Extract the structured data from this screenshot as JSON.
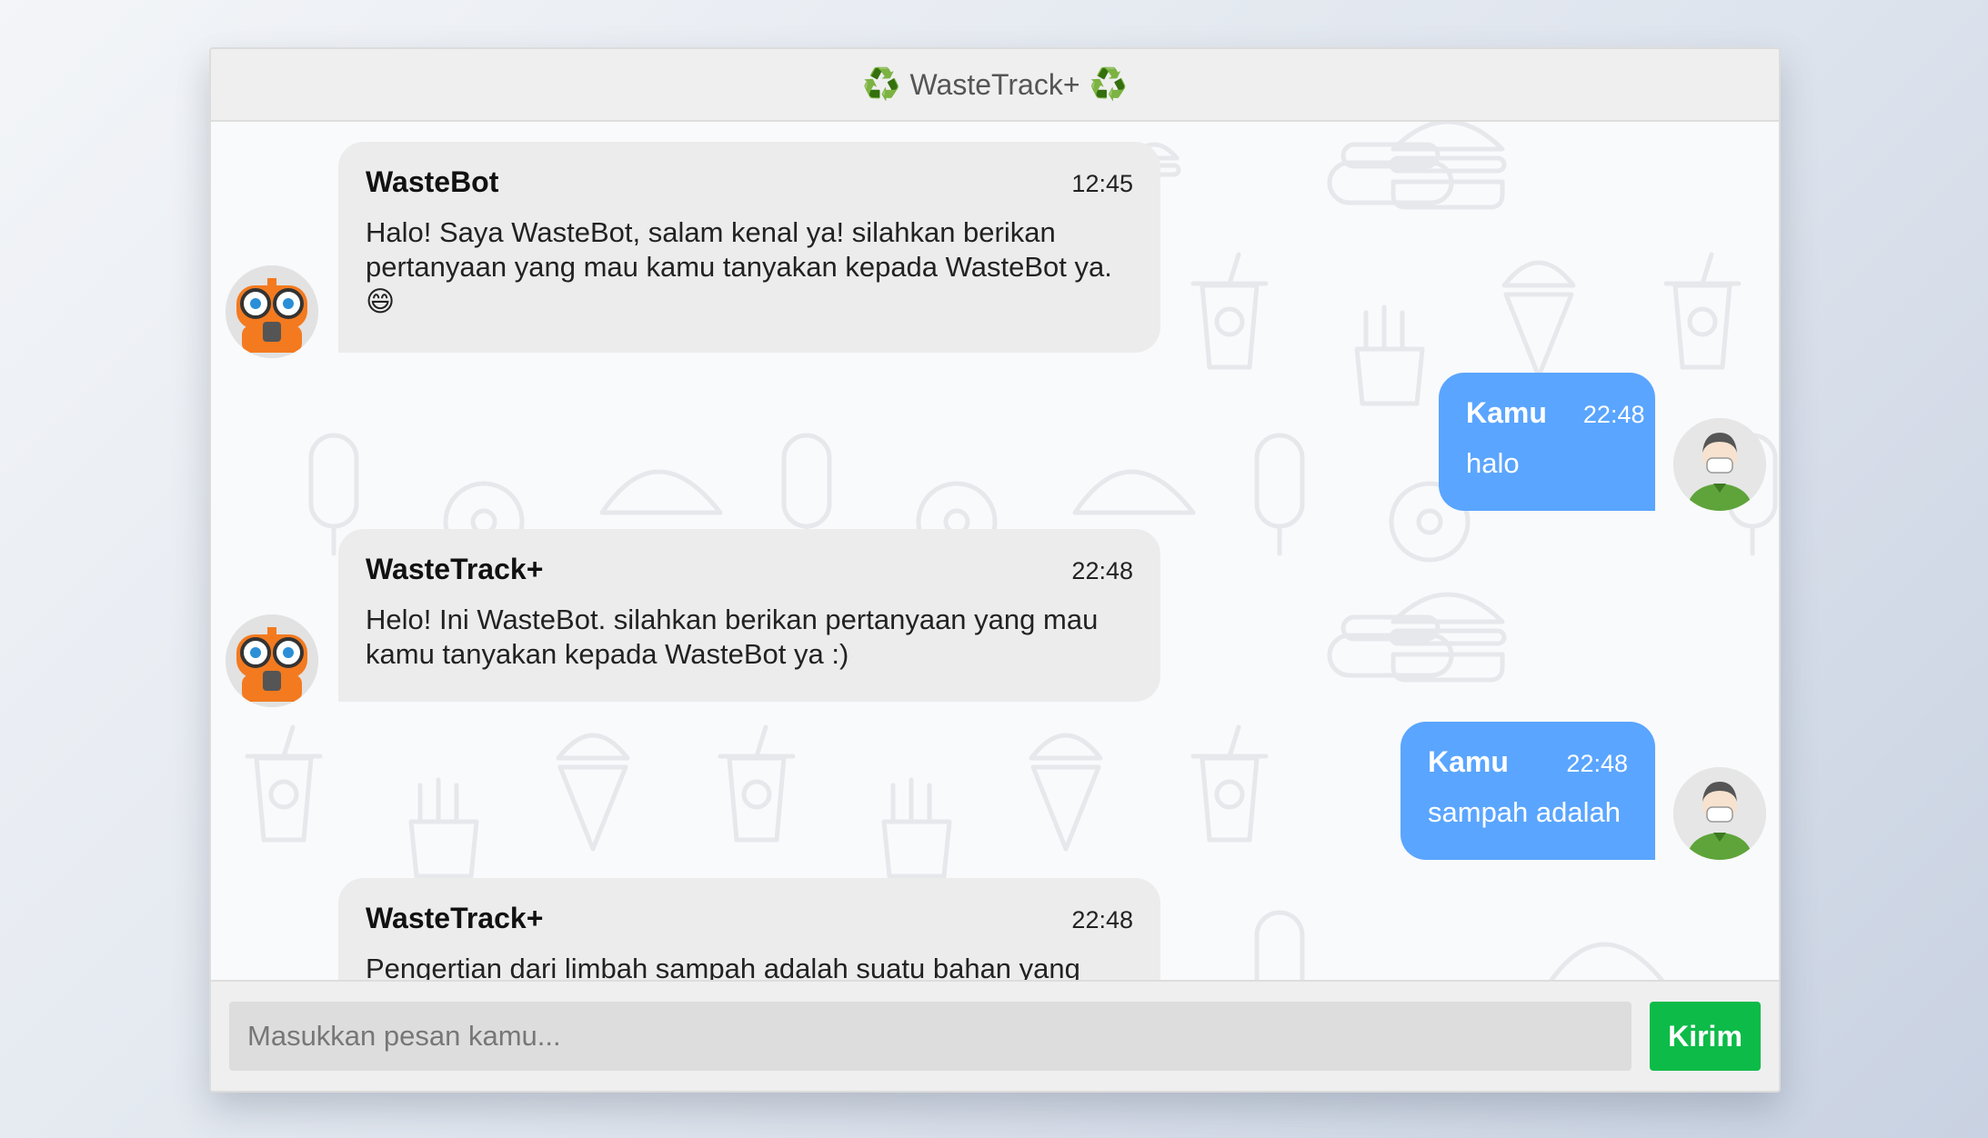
{
  "header": {
    "title": "WasteTrack+",
    "icon": "♻️"
  },
  "messages": [
    {
      "side": "bot",
      "sender": "WasteBot",
      "time": "12:45",
      "text": "Halo! Saya WasteBot, salam kenal ya! silahkan berikan pertanyaan yang mau kamu tanyakan kepada WasteBot ya. 😄"
    },
    {
      "side": "user",
      "sender": "Kamu",
      "time": "22:48",
      "text": "halo"
    },
    {
      "side": "bot",
      "sender": "WasteTrack+",
      "time": "22:48",
      "text": "Helo! Ini WasteBot. silahkan berikan pertanyaan yang mau kamu tanyakan kepada WasteBot ya :)"
    },
    {
      "side": "user",
      "sender": "Kamu",
      "time": "22:48",
      "text": "sampah adalah"
    },
    {
      "side": "bot",
      "sender": "WasteTrack+",
      "time": "22:48",
      "text": "Pengertian dari limbah sampah adalah suatu bahan yang"
    }
  ],
  "input": {
    "placeholder": "Masukkan pesan kamu..."
  },
  "send_button": {
    "label": "Kirim"
  },
  "colors": {
    "user_bubble": "#5aa5ff",
    "bot_bubble": "#ececec",
    "send": "#0dbb48"
  }
}
